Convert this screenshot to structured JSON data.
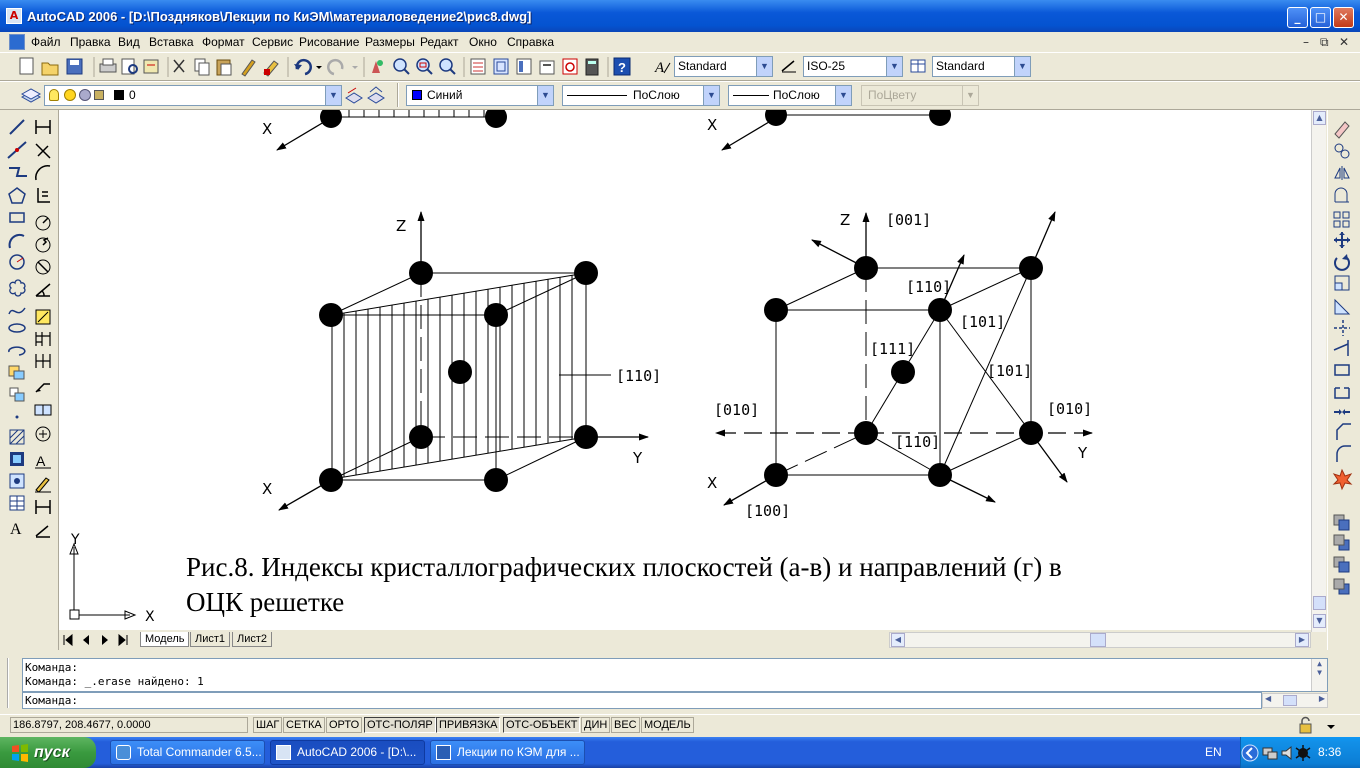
{
  "window": {
    "title": "AutoCAD 2006 - [D:\\Поздняков\\Лекции по КиЭМ\\материаловедение2\\рис8.dwg]",
    "icon_text": "A",
    "minimize": "_",
    "maximize": "□",
    "close": "✕"
  },
  "menu": {
    "items": [
      "Файл",
      "Правка",
      "Вид",
      "Вставка",
      "Формат",
      "Сервис",
      "Рисование",
      "Размеры",
      "Редакт",
      "Окно",
      "Справка"
    ],
    "mdi_minimize": "–",
    "mdi_restore": "⧉",
    "mdi_close": "✕"
  },
  "toolbar": {
    "text_style": "Standard",
    "dim_style": "ISO-25",
    "table_style": "Standard",
    "layer": "0",
    "color": "Синий",
    "linetype": "ПоСлою",
    "lineweight": "ПоСлою",
    "plotstyle": "ПоЦвету",
    "color_swatch": "#0000ff"
  },
  "drawing": {
    "caption_line1": "Рис.8. Индексы кристаллографических плоскостей (а-в) и направлений (г) в",
    "caption_line2": "ОЦК решетке",
    "top_left_x": "X",
    "top_right_x": "X",
    "left_fig": {
      "z": "Z",
      "y": "Y",
      "x": "X",
      "plane_label": "[110]"
    },
    "right_fig": {
      "z": "Z",
      "y": "Y",
      "x": "X",
      "d001": "[001]",
      "d110_top": "[110]",
      "d101_a": "[101]",
      "d111": "[111]",
      "d101_b": "[101]",
      "d010_left": "[010]",
      "d010_right": "[010]",
      "d110_bottom": "[110]",
      "d100": "[100]"
    },
    "ucs_y": "Y",
    "ucs_x": "X"
  },
  "layout_tabs": [
    "Модель",
    "Лист1",
    "Лист2"
  ],
  "command": {
    "history": [
      "Команда:",
      "Команда: _.erase найдено: 1"
    ],
    "prompt": "Команда:"
  },
  "status": {
    "coords": "186.8797, 208.4677, 0.0000",
    "buttons": [
      "ШАГ",
      "СЕТКА",
      "ОРТО",
      "ОТС-ПОЛЯР",
      "ПРИВЯЗКА",
      "ОТС-ОБЪЕКТ",
      "ДИН",
      "ВЕС",
      "МОДЕЛЬ"
    ]
  },
  "taskbar": {
    "start": "пуск",
    "tasks": [
      "Total Commander 6.5...",
      "AutoCAD 2006 - [D:\\...",
      "Лекции по КЭМ для ..."
    ],
    "lang": "EN",
    "clock": "8:36"
  }
}
